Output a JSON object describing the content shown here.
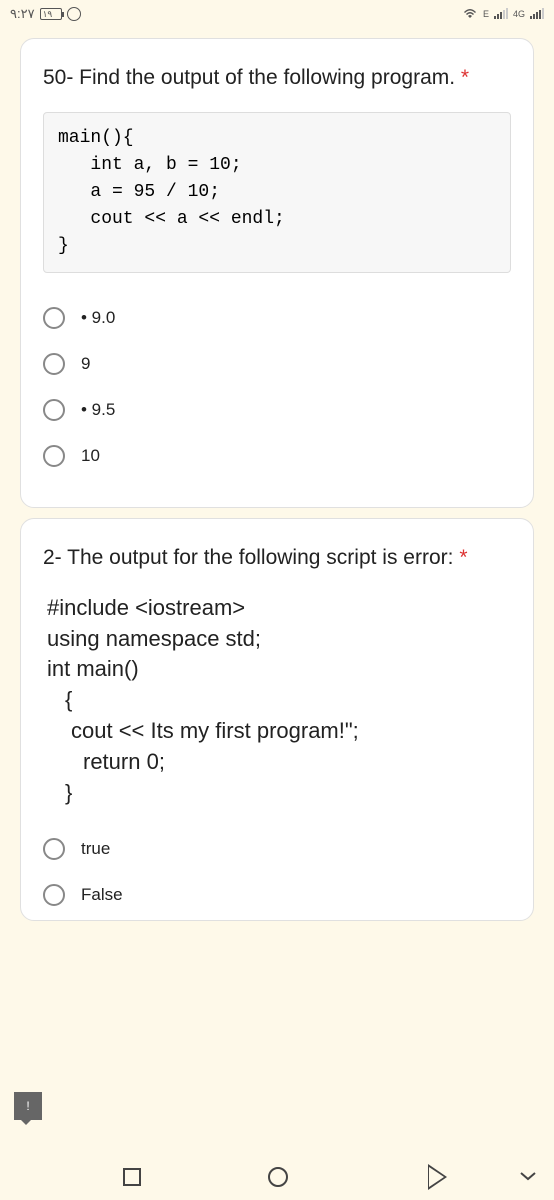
{
  "status_bar": {
    "time": "٩:٢٧",
    "battery_text": "١٩",
    "signal_text_1": "E",
    "signal_text_2": "4G"
  },
  "q1": {
    "text": "50- Find the output of the following program.",
    "required_mark": "*",
    "code": "main(){\n   int a, b = 10;\n   a = 95 / 10;\n   cout << a << endl;\n}",
    "options": [
      {
        "label": "• 9.0"
      },
      {
        "label": "9"
      },
      {
        "label": "• 9.5"
      },
      {
        "label": "10"
      }
    ]
  },
  "q2": {
    "text": "2- The output for the following script is error:",
    "required_mark": "*",
    "code_lines": [
      "#include <iostream>",
      "using namespace std;",
      "int main()",
      " {",
      "  cout << Its my first program!\";",
      "   return 0;",
      " }"
    ],
    "options": [
      {
        "label": "true"
      },
      {
        "label": "False"
      }
    ]
  },
  "feedback_icon": "!"
}
